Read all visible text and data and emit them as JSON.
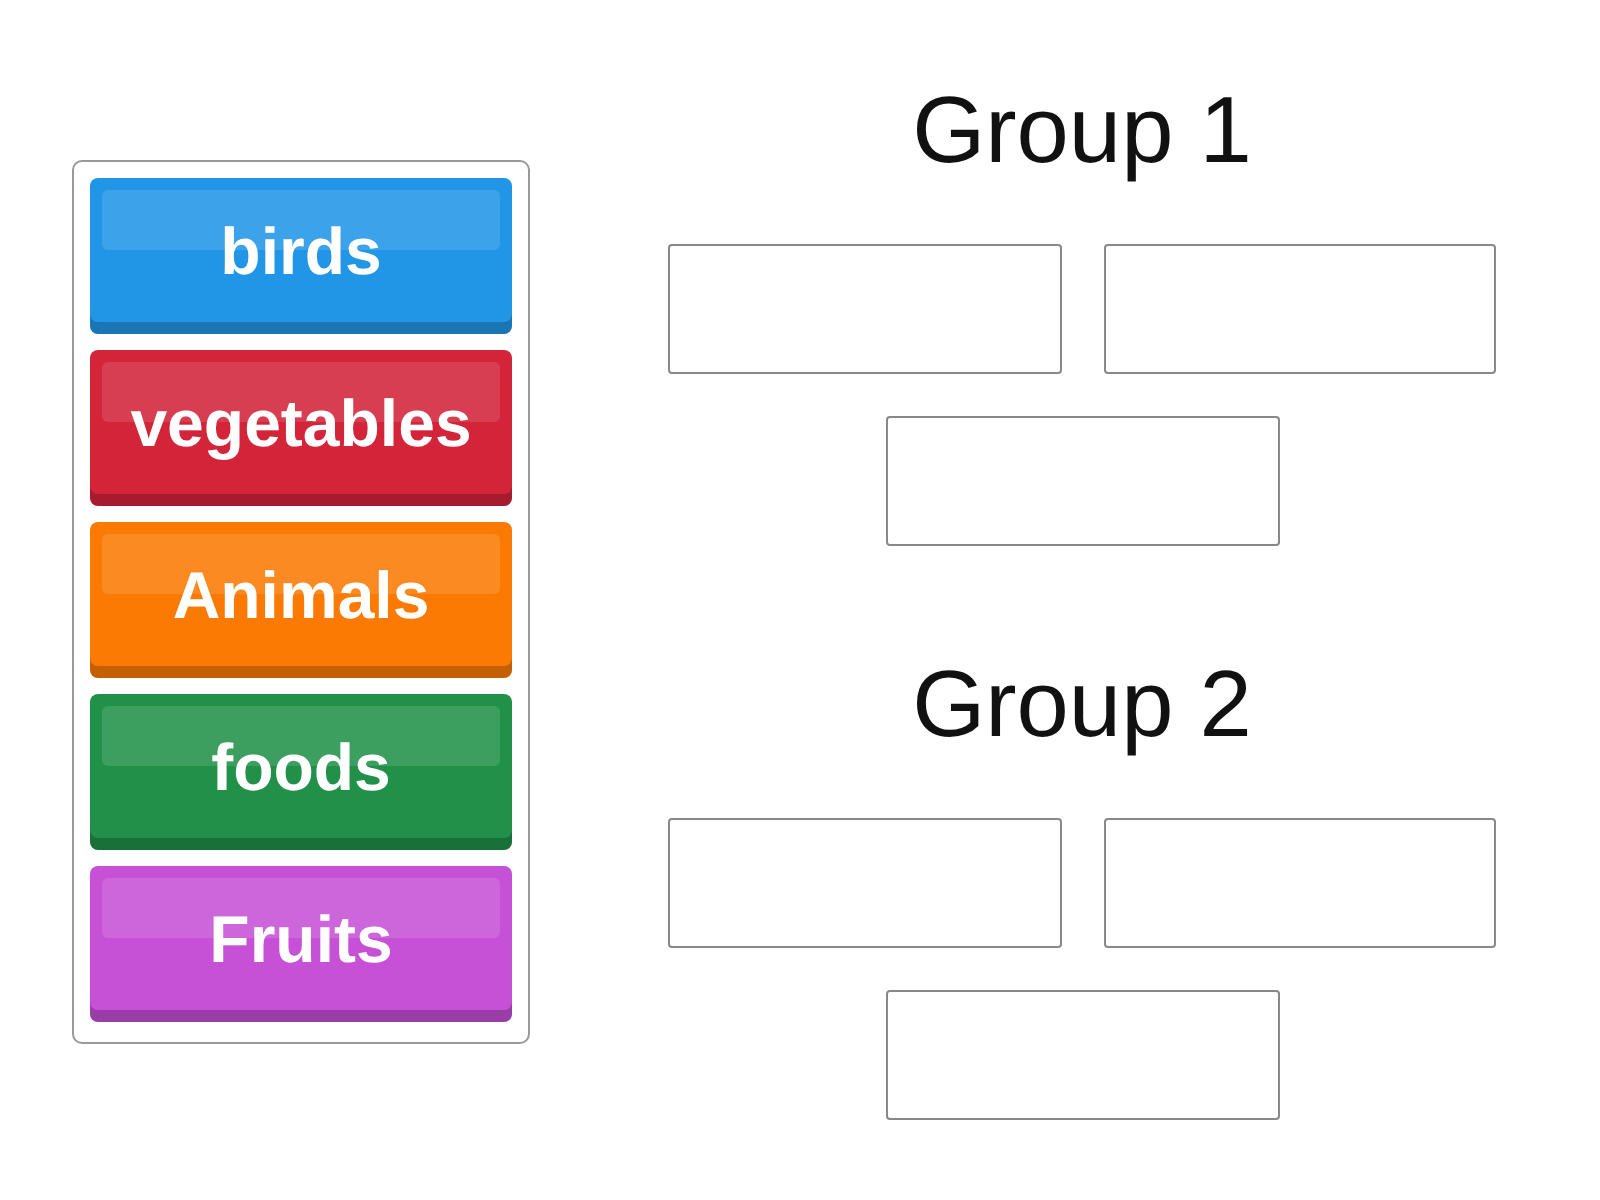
{
  "tiles": [
    {
      "label": "birds",
      "color": "#2196e6"
    },
    {
      "label": "vegetables",
      "color": "#d3243a"
    },
    {
      "label": "Animals",
      "color": "#fb7a04"
    },
    {
      "label": "foods",
      "color": "#219149"
    },
    {
      "label": "Fruits",
      "color": "#c650d6"
    }
  ],
  "groups": [
    {
      "title": "Group 1"
    },
    {
      "title": "Group 2"
    }
  ]
}
